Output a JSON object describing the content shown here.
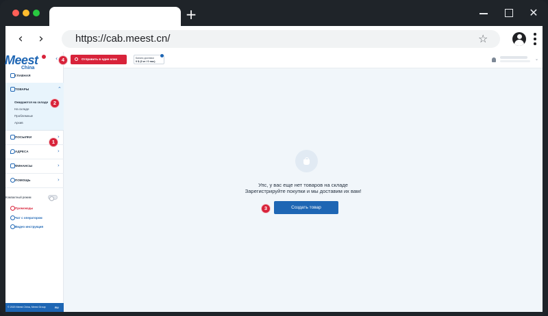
{
  "browser": {
    "url": "https://cab.meest.cn/",
    "new_tab_symbol": "+",
    "back_symbol": "‹",
    "forward_symbol": "›",
    "star_symbol": "☆",
    "close_symbol": "✕"
  },
  "logo": {
    "brand": "Meest",
    "sub": "China"
  },
  "sidebar": {
    "items": [
      {
        "label": "ГЛАВНАЯ",
        "icon": "grid-icon"
      },
      {
        "label": "ТОВАРЫ",
        "icon": "bag-icon",
        "expanded": true
      },
      {
        "label": "ПОСЫЛКИ",
        "icon": "box-icon"
      },
      {
        "label": "АДРЕСА",
        "icon": "pin-icon"
      },
      {
        "label": "ФИНАНСЫ",
        "icon": "wallet-icon"
      },
      {
        "label": "ПОМОЩЬ",
        "icon": "chat-icon"
      }
    ],
    "submenu": [
      "Ожидаются на складе",
      "На складе",
      "Проблемные",
      "Архив"
    ],
    "compact_label": "Компактный режим",
    "links": [
      "Промокоды",
      "Чат с оператором",
      "Видео инструкция"
    ],
    "chevron_down": "⌃",
    "chevron_right": "›",
    "footer_text": "© 2020 Meest China, Meest Group",
    "footer_lang": "RU"
  },
  "topbar": {
    "collapse_symbol": "‹",
    "send_label": "Отправить в один клик",
    "balance_title": "Баланс доставки",
    "balance_value": "0 $ (0 кг / 0 пос)",
    "caret": "⌄"
  },
  "main": {
    "empty_line1": "Упс, у вас еще нет товаров на складе",
    "empty_line2": "Зарегистрируйте покупки и мы доставим их вам!",
    "create_button": "Создать товар"
  },
  "badges": [
    "1",
    "2",
    "3",
    "4"
  ],
  "colors": {
    "brand_blue": "#1e66b4",
    "brand_red": "#d8233a"
  }
}
